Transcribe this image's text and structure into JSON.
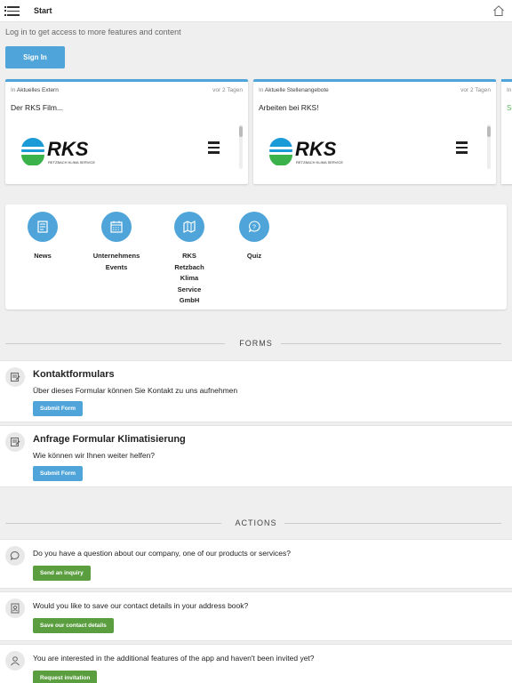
{
  "header": {
    "title": "Start",
    "menu_icon": "menu-icon",
    "home_icon": "home-icon"
  },
  "login": {
    "text": "Log in to get access to more features and content",
    "button": "Sign In"
  },
  "cards": [
    {
      "in_prefix": "In",
      "category": "Aktuelles Extern",
      "time": "vor 2 Tagen",
      "title": "Der RKS Film...",
      "logo_text": "RKS",
      "logo_sub": "RETZBACH KLIMA SERVICE"
    },
    {
      "in_prefix": "In",
      "category": "Aktuelle Stellenangebote",
      "time": "vor 2 Tagen",
      "title": "Arbeiten bei RKS!",
      "logo_text": "RKS",
      "logo_sub": "RETZBACH KLIMA SERVICE"
    }
  ],
  "partial_card": {
    "in_prefix": "In",
    "teaser": "Se"
  },
  "shortcuts": [
    {
      "icon": "newspaper-icon",
      "label": "News"
    },
    {
      "icon": "calendar-icon",
      "label": "Unternehmens Events"
    },
    {
      "icon": "map-icon",
      "label": "RKS Retzbach Klima Service GmbH"
    },
    {
      "icon": "quiz-icon",
      "label": "Quiz"
    }
  ],
  "forms": {
    "section_title": "FORMS",
    "items": [
      {
        "title": "Kontaktformulars",
        "description": "Über dieses Formular können Sie Kontakt zu uns aufnehmen",
        "button": "Submit Form"
      },
      {
        "title": "Anfrage Formular Klimatisierung",
        "description": "Wie können wir Ihnen weiter helfen?",
        "button": "Submit Form"
      }
    ]
  },
  "actions": {
    "section_title": "ACTIONS",
    "items": [
      {
        "icon": "chat-icon",
        "description": "Do you have a question about our company, one of our products or services?",
        "button": "Send an inquiry"
      },
      {
        "icon": "address-book-icon",
        "description": "Would you like to save our contact details in your address book?",
        "button": "Save our contact details"
      },
      {
        "icon": "user-icon",
        "description": "You are interested in the additional features of the app and haven't been invited yet?",
        "button": "Request invitation"
      }
    ]
  },
  "colors": {
    "primary": "#4fa5da",
    "action_green": "#5a9e3f",
    "background": "#efefef"
  }
}
